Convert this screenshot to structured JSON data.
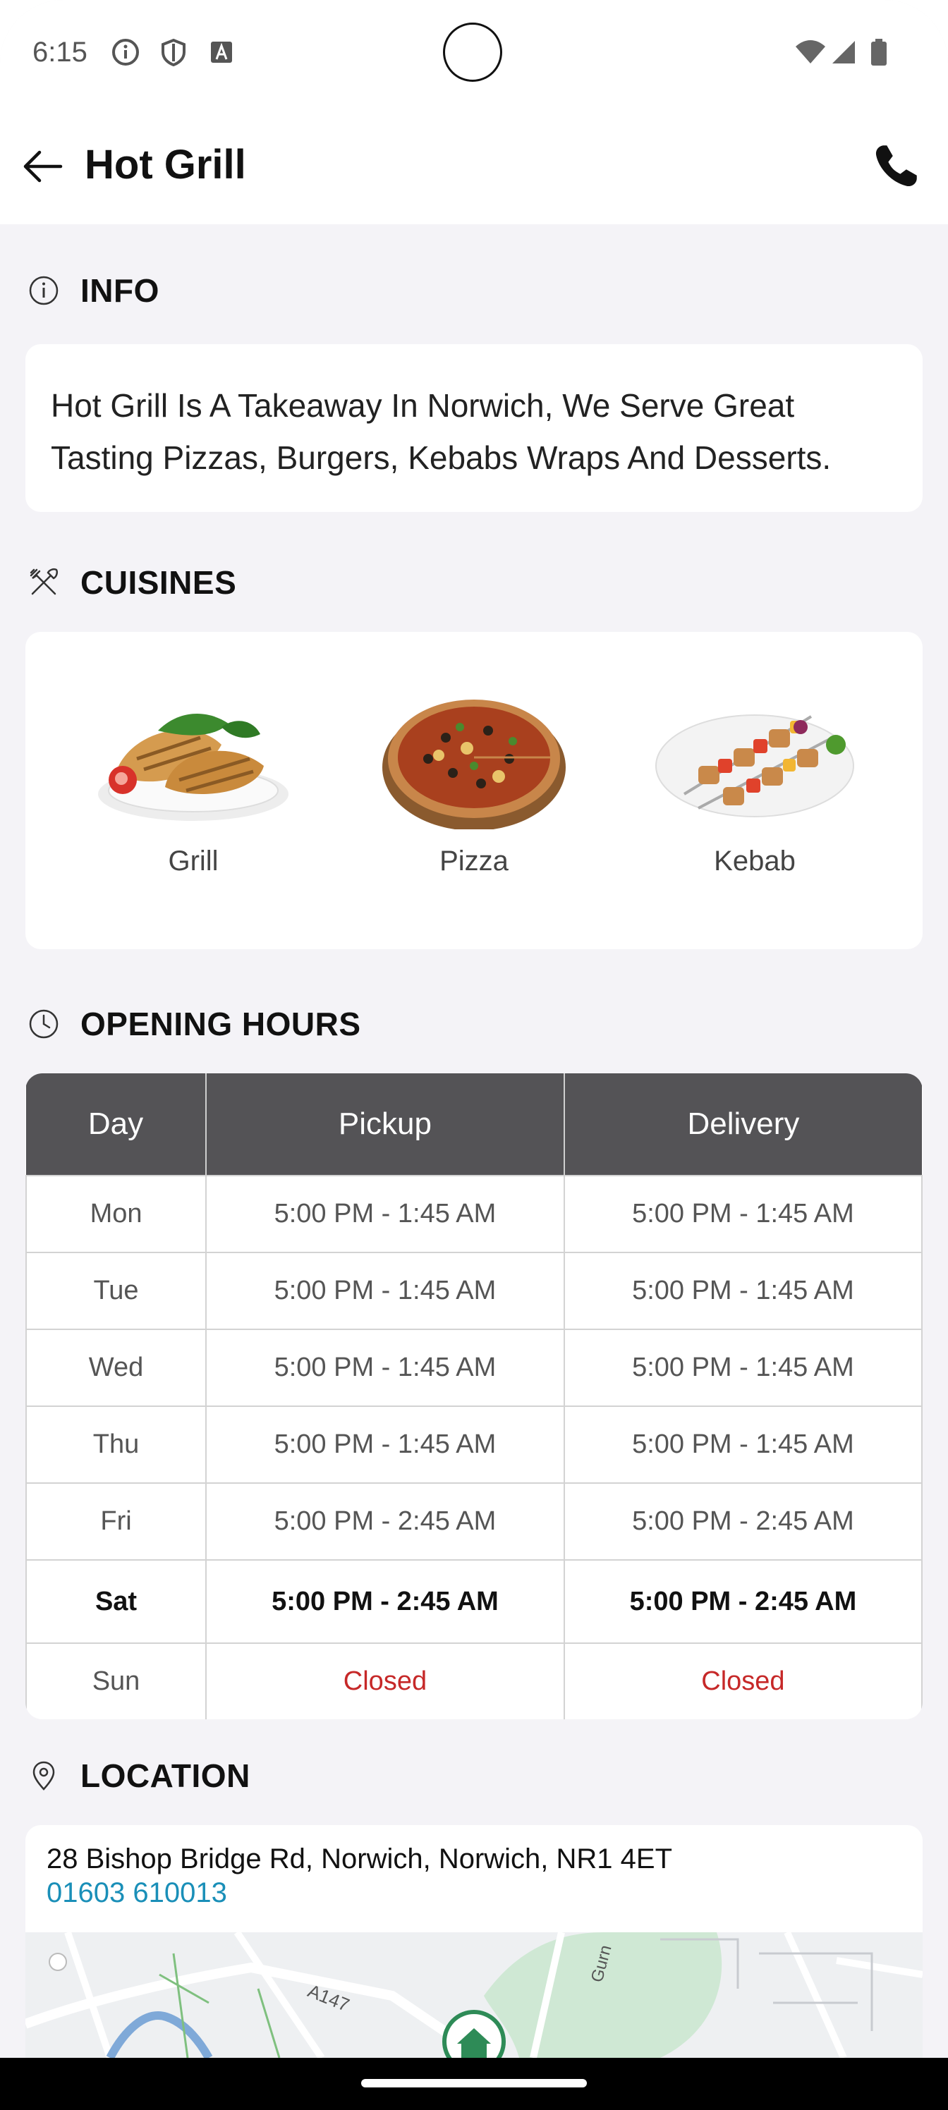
{
  "status_bar": {
    "time": "6:15"
  },
  "app_bar": {
    "title": "Hot Grill"
  },
  "info": {
    "heading": "INFO",
    "description": "Hot Grill Is A Takeaway In Norwich, We Serve Great Tasting Pizzas, Burgers, Kebabs Wraps And Desserts."
  },
  "cuisines": {
    "heading": "CUISINES",
    "items": [
      {
        "label": "Grill"
      },
      {
        "label": "Pizza"
      },
      {
        "label": "Kebab"
      }
    ]
  },
  "opening_hours": {
    "heading": "OPENING HOURS",
    "columns": [
      "Day",
      "Pickup",
      "Delivery"
    ],
    "rows": [
      {
        "day": "Mon",
        "pickup": "5:00 PM - 1:45 AM",
        "delivery": "5:00 PM - 1:45 AM"
      },
      {
        "day": "Tue",
        "pickup": "5:00 PM - 1:45 AM",
        "delivery": "5:00 PM - 1:45 AM"
      },
      {
        "day": "Wed",
        "pickup": "5:00 PM - 1:45 AM",
        "delivery": "5:00 PM - 1:45 AM"
      },
      {
        "day": "Thu",
        "pickup": "5:00 PM - 1:45 AM",
        "delivery": "5:00 PM - 1:45 AM"
      },
      {
        "day": "Fri",
        "pickup": "5:00 PM - 2:45 AM",
        "delivery": "5:00 PM - 2:45 AM"
      },
      {
        "day": "Sat",
        "pickup": "5:00 PM - 2:45 AM",
        "delivery": "5:00 PM - 2:45 AM"
      },
      {
        "day": "Sun",
        "pickup": "Closed",
        "delivery": "Closed"
      }
    ],
    "closed_color": "#c62828",
    "header_color": "#545356"
  },
  "location": {
    "heading": "LOCATION",
    "address": "28 Bishop Bridge Rd, Norwich, Norwich, NR1 4ET",
    "phone": "01603 610013",
    "phone_color": "#1a8fb8",
    "map_labels": {
      "road": "A147",
      "street": "Gurn"
    }
  },
  "icons": [
    "back-arrow-icon",
    "phone-icon",
    "info-icon",
    "utensils-icon",
    "clock-icon",
    "location-pin-icon",
    "home-marker-icon"
  ]
}
